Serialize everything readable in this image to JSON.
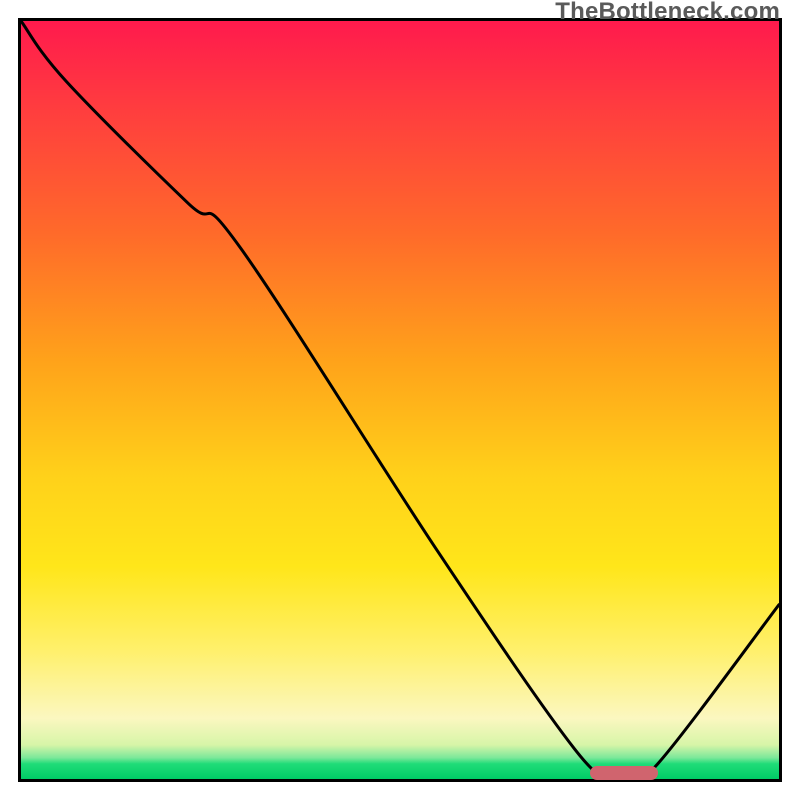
{
  "watermark": "TheBottleneck.com",
  "colors": {
    "gradient_top": "#ff1a4d",
    "gradient_mid": "#ffd11a",
    "gradient_bottom": "#00cc66",
    "curve": "#000000",
    "marker": "#d0646e",
    "border": "#000000"
  },
  "chart_data": {
    "type": "line",
    "title": "",
    "xlabel": "",
    "ylabel": "",
    "xlim": [
      0,
      100
    ],
    "ylim": [
      0,
      100
    ],
    "x": [
      0,
      6,
      22,
      29,
      55,
      73,
      78,
      80,
      84,
      100
    ],
    "values": [
      100,
      92,
      76,
      70,
      30,
      4,
      0.5,
      0.5,
      2,
      23
    ],
    "series": [
      {
        "name": "bottleneck-curve",
        "x": [
          0,
          6,
          22,
          29,
          55,
          73,
          78,
          80,
          84,
          100
        ],
        "values": [
          100,
          92,
          76,
          70,
          30,
          4,
          0.5,
          0.5,
          2,
          23
        ]
      }
    ],
    "marker": {
      "x_start": 75,
      "x_end": 84,
      "y": 0.8
    },
    "grid": false,
    "legend": false
  }
}
